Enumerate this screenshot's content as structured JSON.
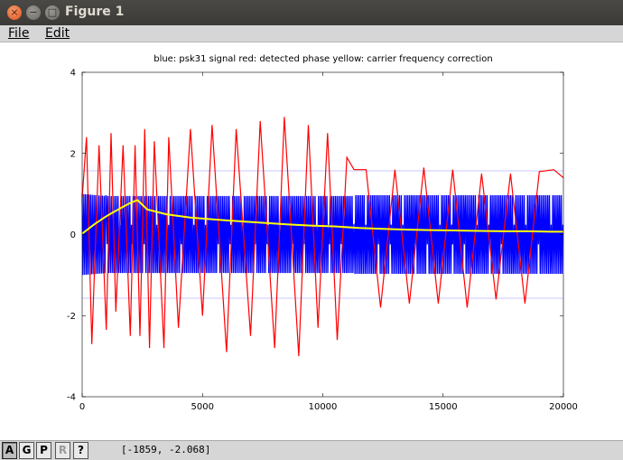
{
  "window": {
    "title": "Figure 1",
    "close_glyph": "×",
    "minimize_glyph": "−",
    "maximize_glyph": "□"
  },
  "menu": {
    "file_label": "File",
    "edit_label": "Edit"
  },
  "plot": {
    "title": "blue: psk31 signal    red: detected phase    yellow: carrier frequency correction"
  },
  "toolbar": {
    "a_label": "A",
    "g_label": "G",
    "p_label": "P",
    "r_label": "R",
    "help_label": "?",
    "coordinates": "[-1859, -2.068]"
  },
  "colors": {
    "signal": "#0000ff",
    "phase": "#ff0000",
    "correction": "#ffff00",
    "reference_lines": "#c8c8ff"
  },
  "chart_data": {
    "type": "line",
    "title": "blue: psk31 signal    red: detected phase    yellow: carrier frequency correction",
    "xlabel": "",
    "ylabel": "",
    "xlim": [
      0,
      20000
    ],
    "ylim": [
      -4,
      4
    ],
    "xticks": [
      0,
      5000,
      10000,
      15000,
      20000
    ],
    "yticks": [
      -4,
      -2,
      0,
      2,
      4
    ],
    "reference_lines_y": [
      1.5708,
      -1.5708
    ],
    "grid": false,
    "legend": "none",
    "series": [
      {
        "description": "psk31 signal",
        "color": "#0000ff",
        "style": "oscillating envelope",
        "segments": [
          {
            "x0": 0,
            "x1": 1000,
            "env_hi": [
              1.0,
              0.95
            ],
            "env_lo": [
              -1.0,
              -0.95
            ]
          },
          {
            "x0": 1000,
            "x1": 11300,
            "env_hi": [
              0.95,
              0.95
            ],
            "env_lo": [
              -0.95,
              -0.95
            ],
            "bursts": "symbol nulls every ~512 samples"
          },
          {
            "x0": 11300,
            "x1": 20000,
            "env_hi": [
              0.97,
              0.97
            ],
            "env_lo": [
              -0.97,
              -0.97
            ],
            "bursts": "continuous with periodic nulls"
          }
        ]
      },
      {
        "description": "detected phase",
        "color": "#ff0000",
        "x": [
          0,
          180,
          400,
          700,
          1000,
          1200,
          1400,
          1700,
          2000,
          2200,
          2400,
          2600,
          2800,
          3000,
          3400,
          3600,
          4000,
          4500,
          5000,
          5400,
          6000,
          6400,
          7000,
          7400,
          8000,
          8400,
          9000,
          9400,
          9800,
          10200,
          10600,
          11000,
          11300,
          11800,
          12400,
          13000,
          13600,
          14200,
          14800,
          15400,
          16000,
          16600,
          17200,
          17800,
          18400,
          19000,
          19600,
          20000
        ],
        "y": [
          0.9,
          2.4,
          -2.7,
          2.2,
          -2.35,
          2.5,
          -1.9,
          2.2,
          -2.5,
          2.2,
          -2.5,
          2.6,
          -2.8,
          2.3,
          -2.8,
          2.4,
          -2.3,
          2.6,
          -2.0,
          2.7,
          -2.9,
          2.6,
          -2.5,
          2.8,
          -2.8,
          2.9,
          -3.0,
          2.7,
          -2.3,
          2.5,
          -2.6,
          1.9,
          1.6,
          1.6,
          -1.8,
          1.6,
          -1.7,
          1.65,
          -1.7,
          1.6,
          -1.8,
          1.5,
          -1.6,
          1.5,
          -1.7,
          1.55,
          1.6,
          1.4
        ]
      },
      {
        "description": "carrier frequency correction",
        "color": "#ffff00",
        "x": [
          0,
          500,
          1000,
          1500,
          2000,
          2300,
          2700,
          3500,
          4500,
          5500,
          6500,
          7500,
          8500,
          9500,
          10500,
          11500,
          12500,
          13500,
          14500,
          15500,
          16500,
          17500,
          18500,
          19500,
          20000
        ],
        "y": [
          0.02,
          0.25,
          0.45,
          0.62,
          0.78,
          0.85,
          0.62,
          0.5,
          0.42,
          0.37,
          0.33,
          0.29,
          0.25,
          0.22,
          0.2,
          0.16,
          0.14,
          0.12,
          0.11,
          0.1,
          0.09,
          0.08,
          0.08,
          0.07,
          0.07
        ]
      }
    ]
  }
}
